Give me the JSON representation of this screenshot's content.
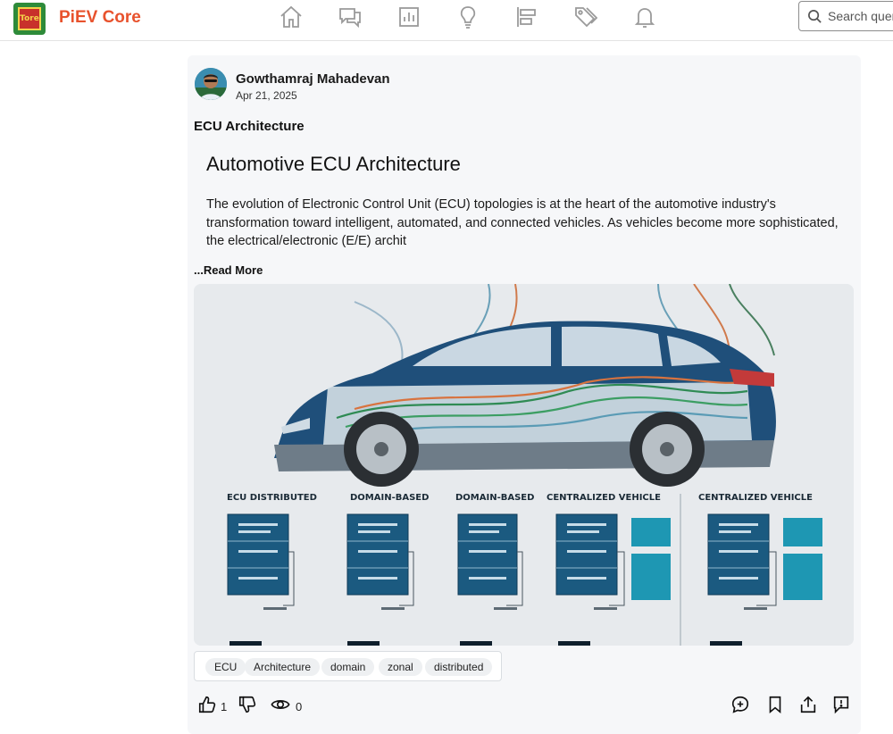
{
  "app": {
    "brand": "PiEV Core",
    "logo_text": "Tore"
  },
  "nav": [
    {
      "name": "home-icon"
    },
    {
      "name": "discussions-icon"
    },
    {
      "name": "analytics-icon"
    },
    {
      "name": "ideas-icon"
    },
    {
      "name": "timeline-icon"
    },
    {
      "name": "tags-icon"
    },
    {
      "name": "notifications-icon"
    }
  ],
  "search": {
    "placeholder": "Search queri"
  },
  "post": {
    "author": "Gowthamraj Mahadevan",
    "date": "Apr 21, 2025",
    "title": "ECU Architecture",
    "article_heading": "Automotive ECU Architecture",
    "excerpt": "The evolution of Electronic Control Unit (ECU) topologies is at the heart of the automotive industry's transformation toward intelligent, automated, and connected vehicles. As vehicles become more sophisticated, the electrical/electronic (E/E) archit",
    "read_more": "...Read More",
    "cover": {
      "column_labels": [
        "ECU DISTRIBUTED",
        "DOMAIN-BASED",
        "DOMAIN-BASED",
        "CENTRALIZED VEHICLE",
        "CENTRALIZED VEHICLE"
      ],
      "accent_colors": {
        "body": "#1f4f7a",
        "box": "#1b5a80",
        "teal": "#1e97b3"
      }
    },
    "tags": [
      "ECU",
      "Architecture",
      "domain",
      "zonal",
      "distributed"
    ],
    "likes": "1",
    "views": "0"
  }
}
